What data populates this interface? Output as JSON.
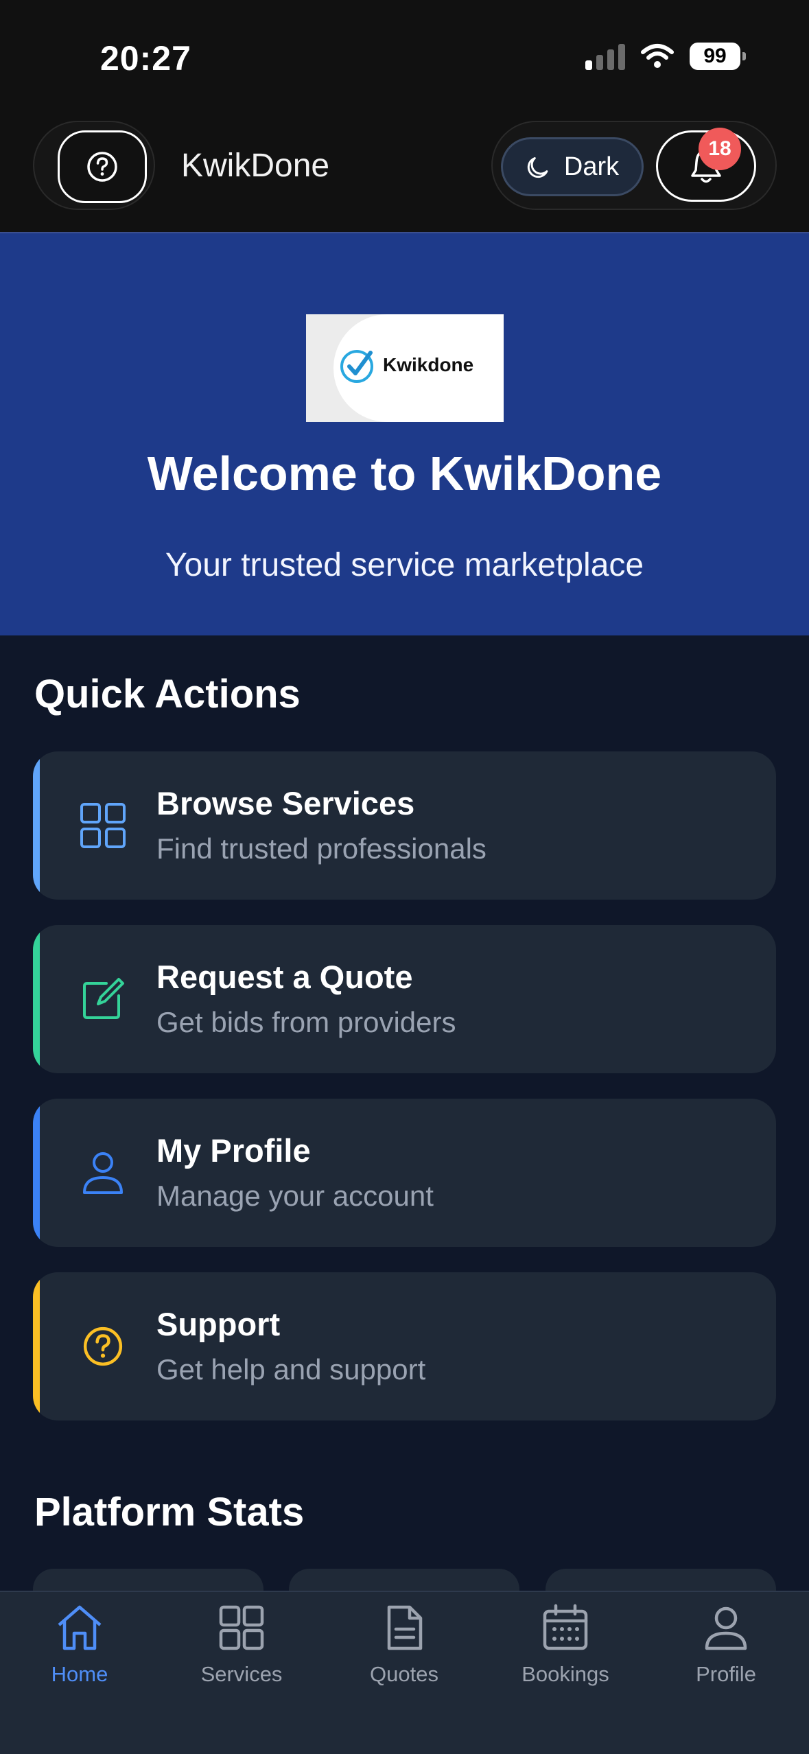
{
  "status_bar": {
    "time": "20:27",
    "battery": "99"
  },
  "header": {
    "app_title": "KwikDone",
    "theme_toggle_label": "Dark",
    "notification_count": "18"
  },
  "hero": {
    "logo_text": "Kwikdone",
    "title": "Welcome to KwikDone",
    "subtitle": "Your trusted service marketplace"
  },
  "quick_actions": {
    "title": "Quick Actions",
    "items": [
      {
        "title": "Browse Services",
        "subtitle": "Find trusted professionals",
        "icon": "grid-icon",
        "color": "#60a5fa"
      },
      {
        "title": "Request a Quote",
        "subtitle": "Get bids from providers",
        "icon": "edit-icon",
        "color": "#34d399"
      },
      {
        "title": "My Profile",
        "subtitle": "Manage your account",
        "icon": "user-icon",
        "color": "#3b82f6"
      },
      {
        "title": "Support",
        "subtitle": "Get help and support",
        "icon": "help-icon",
        "color": "#fbbf24"
      }
    ]
  },
  "platform_stats": {
    "title": "Platform Stats"
  },
  "bottom_nav": {
    "items": [
      {
        "label": "Home",
        "icon": "home-icon",
        "active": true
      },
      {
        "label": "Services",
        "icon": "grid-icon",
        "active": false
      },
      {
        "label": "Quotes",
        "icon": "document-icon",
        "active": false
      },
      {
        "label": "Bookings",
        "icon": "calendar-icon",
        "active": false
      },
      {
        "label": "Profile",
        "icon": "user-icon",
        "active": false
      }
    ]
  }
}
